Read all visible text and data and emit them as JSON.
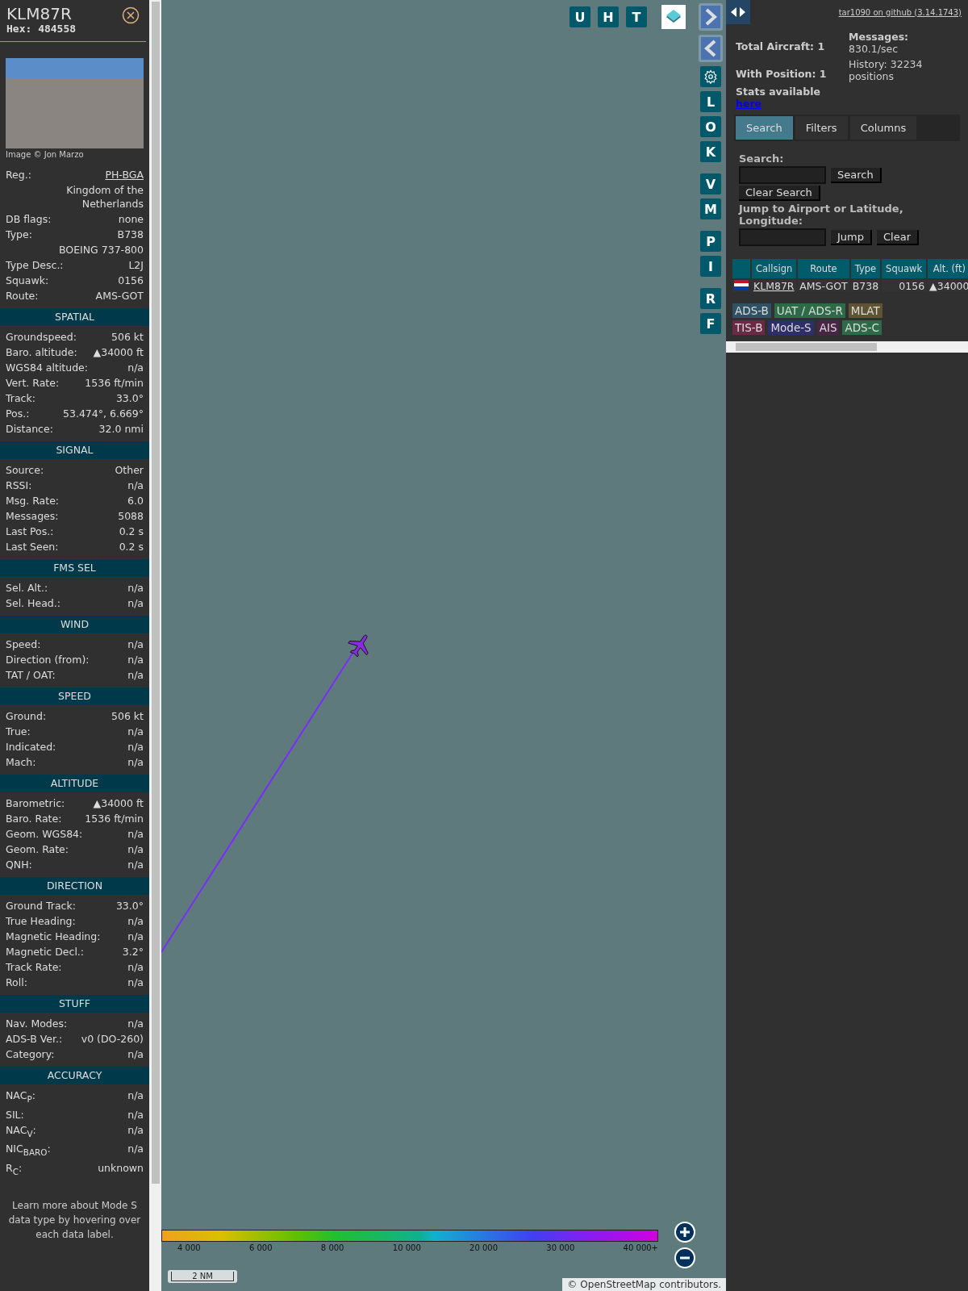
{
  "aircraft": {
    "callsign": "KLM87R",
    "hex": "Hex: 484558",
    "photo_credit": "Image © Jon Marzo"
  },
  "info_rows": [
    {
      "label": "Reg.:",
      "value": "PH-BGA",
      "kind": "link"
    },
    {
      "label": "",
      "value": "Kingdom of the Netherlands",
      "kind": "text"
    },
    {
      "label": "DB flags:",
      "value": "none",
      "kind": "text"
    },
    {
      "label": "Type:",
      "value": "B738",
      "kind": "text"
    },
    {
      "label": "",
      "value": "BOEING 737-800",
      "kind": "text"
    },
    {
      "label": "Type Desc.:",
      "value": "L2J",
      "kind": "text"
    },
    {
      "label": "Squawk:",
      "value": "0156",
      "kind": "text"
    },
    {
      "label": "Route:",
      "value": "AMS-GOT",
      "kind": "text"
    }
  ],
  "sections": [
    {
      "title": "SPATIAL",
      "rows": [
        {
          "label": "Groundspeed:",
          "value": "506 kt"
        },
        {
          "label": "Baro. altitude:",
          "value": "▲34000 ft"
        },
        {
          "label": "WGS84 altitude:",
          "value": "n/a"
        },
        {
          "label": "Vert. Rate:",
          "value": "1536 ft/min"
        },
        {
          "label": "Track:",
          "value": "33.0°"
        },
        {
          "label": "Pos.:",
          "value": "53.474°, 6.669°"
        },
        {
          "label": "Distance:",
          "value": "32.0 nmi"
        }
      ]
    },
    {
      "title": "SIGNAL",
      "rows": [
        {
          "label": "Source:",
          "value": "Other"
        },
        {
          "label": "RSSI:",
          "value": "n/a"
        },
        {
          "label": "Msg. Rate:",
          "value": "6.0"
        },
        {
          "label": "Messages:",
          "value": "5088"
        },
        {
          "label": "Last Pos.:",
          "value": "0.2 s"
        },
        {
          "label": "Last Seen:",
          "value": "0.2 s"
        }
      ]
    },
    {
      "title": "FMS SEL",
      "rows": [
        {
          "label": "Sel. Alt.:",
          "value": "n/a"
        },
        {
          "label": "Sel. Head.:",
          "value": "n/a"
        }
      ]
    },
    {
      "title": "WIND",
      "rows": [
        {
          "label": "Speed:",
          "value": "n/a"
        },
        {
          "label": "Direction (from):",
          "value": "n/a"
        },
        {
          "label": "TAT / OAT:",
          "value": "n/a"
        }
      ]
    },
    {
      "title": "SPEED",
      "rows": [
        {
          "label": "Ground:",
          "value": "506 kt"
        },
        {
          "label": "True:",
          "value": "n/a"
        },
        {
          "label": "Indicated:",
          "value": "n/a"
        },
        {
          "label": "Mach:",
          "value": "n/a"
        }
      ]
    },
    {
      "title": "ALTITUDE",
      "rows": [
        {
          "label": "Barometric:",
          "value": "▲34000 ft"
        },
        {
          "label": "Baro. Rate:",
          "value": "1536 ft/min"
        },
        {
          "label": "Geom. WGS84:",
          "value": "n/a"
        },
        {
          "label": "Geom. Rate:",
          "value": "n/a"
        },
        {
          "label": "QNH:",
          "value": "n/a"
        }
      ]
    },
    {
      "title": "DIRECTION",
      "rows": [
        {
          "label": "Ground Track:",
          "value": "33.0°"
        },
        {
          "label": "True Heading:",
          "value": "n/a"
        },
        {
          "label": "Magnetic Heading:",
          "value": "n/a"
        },
        {
          "label": "Magnetic Decl.:",
          "value": "3.2°"
        },
        {
          "label": "Track Rate:",
          "value": "n/a"
        },
        {
          "label": "Roll:",
          "value": "n/a"
        }
      ]
    },
    {
      "title": "STUFF",
      "rows": [
        {
          "label": "Nav. Modes:",
          "value": "n/a"
        },
        {
          "label": "ADS-B Ver.:",
          "value": "v0 (DO-260)"
        },
        {
          "label": "Category:",
          "value": "n/a"
        }
      ]
    },
    {
      "title": "ACCURACY",
      "rows": [
        {
          "label": "NAC$_{P}$:",
          "value": "n/a"
        },
        {
          "label": "SIL:",
          "value": "n/a"
        },
        {
          "label": "NAC$_{V}$:",
          "value": "n/a"
        },
        {
          "label": "NIC$_{BARO}$:",
          "value": "n/a"
        },
        {
          "label": "R$_{C}$:",
          "value": "unknown"
        }
      ]
    }
  ],
  "footer_note": "Learn more about Mode S data type by hovering over each data label.",
  "map_top_buttons": [
    "U",
    "H",
    "T"
  ],
  "map_side_buttons": [
    "L",
    "O",
    "K",
    "V",
    "M",
    "P",
    "I",
    "R",
    "F"
  ],
  "altitude_legend": [
    "4 000",
    "6 000",
    "8 000",
    "10 000",
    "20 000",
    "30 000",
    "40 000+"
  ],
  "scale": "2 NM",
  "attribution": {
    "prefix": "©",
    "link": "OpenStreetMap",
    "suffix": "contributors."
  },
  "github_link": "tar1090 on github (3.14.1743)",
  "stats": {
    "total": "Total Aircraft: 1",
    "with_position": "With Position: 1",
    "stats_available": "Stats available",
    "here_link": "here",
    "messages_label": "Messages:",
    "messages_value": "830.1/sec",
    "history": "History: 32234 positions"
  },
  "tabs": [
    {
      "label": "Search",
      "selected": true
    },
    {
      "label": "Filters",
      "selected": false
    },
    {
      "label": "Columns",
      "selected": false
    }
  ],
  "search": {
    "label": "Search:",
    "button": "Search",
    "clear_button": "Clear Search",
    "jump_label": "Jump to Airport or Latitude, Longitude:",
    "jump_button": "Jump",
    "clear_jump_button": "Clear"
  },
  "table": {
    "columns": [
      "Callsign",
      "Route",
      "Type",
      "Squawk",
      "Alt. (ft)"
    ],
    "rows": [
      {
        "callsign": "KLM87R",
        "route": "AMS-GOT",
        "type": "B738",
        "squawk": "0156",
        "altitude": "▲34000",
        "selected": false
      }
    ]
  },
  "sources": [
    {
      "label": "ADS-B",
      "color": "#2f5164"
    },
    {
      "label": "UAT / ADS-R",
      "color": "#2c6a48"
    },
    {
      "label": "MLAT",
      "color": "#5e5434"
    },
    {
      "label": "TIS-B",
      "color": "#6a2a44"
    },
    {
      "label": "Mode-S",
      "color": "#2e2e6a"
    },
    {
      "label": "AIS",
      "color": "#4a2444"
    },
    {
      "label": "ADS-C",
      "color": "#2c6a48"
    }
  ]
}
